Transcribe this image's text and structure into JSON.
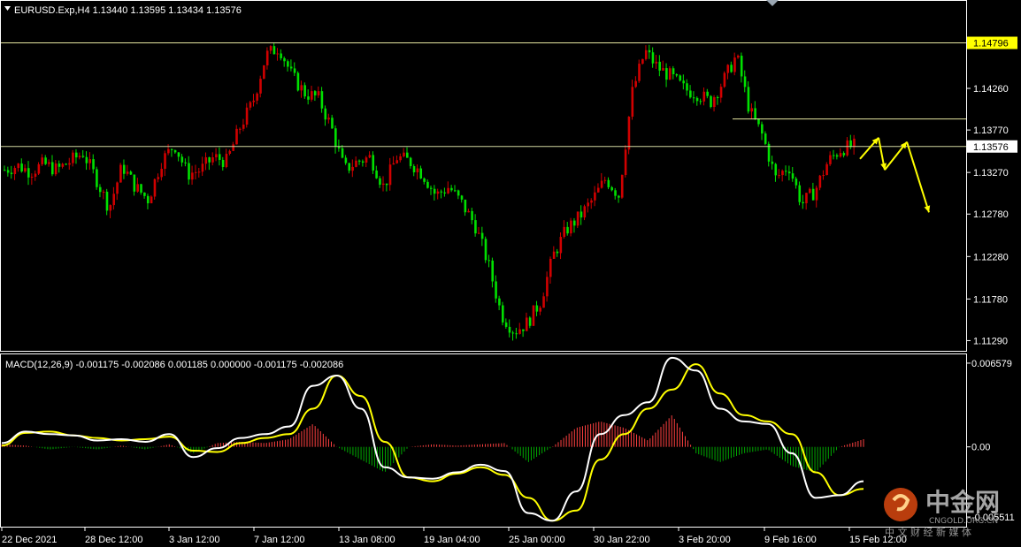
{
  "window": {
    "symbol_header": "EURUSD.Exp,H4  1.13440 1.13595 1.13434 1.13576",
    "collapse_icon": "triangle-down-icon"
  },
  "colors": {
    "background": "#000000",
    "frame": "#ffffff",
    "bull_candle": "#d00000",
    "bear_candle": "#00e000",
    "hline": "#e6e6a0",
    "yellow": "#ffff00",
    "macd_main": "#ffffff",
    "macd_signal": "#ffff00",
    "hist_pos": "#ff4040",
    "hist_neg": "#00aa00"
  },
  "price_axis": {
    "ticks": [
      "1.14260",
      "1.13770",
      "1.13270",
      "1.12780",
      "1.12280",
      "1.11780",
      "1.11290"
    ],
    "highlight_label": "1.14796",
    "current_label": "1.13576"
  },
  "macd_panel": {
    "header": "MACD(12,26,9) -0.001175 -0.002086 0.001185 0.000000 -0.001175 -0.002086",
    "ticks": [
      "0.006579",
      "0.00",
      "-0.005511"
    ]
  },
  "time_axis": {
    "labels": [
      "22 Dec 2021",
      "28 Dec 12:00",
      "3 Jan 12:00",
      "7 Jan 12:00",
      "13 Jan 08:00",
      "19 Jan 04:00",
      "25 Jan 00:00",
      "30 Jan 22:00",
      "3 Feb 20:00",
      "9 Feb 16:00",
      "15 Feb 12:00"
    ]
  },
  "watermark": {
    "brand": "中金网",
    "domain": "CNGOLD.ORG.CN",
    "slogan": "中 文 财 经 新 媒 体",
    "logo_icon": "cngold-logo-icon"
  },
  "chart_data": [
    {
      "type": "candlestick",
      "title": "EURUSD.Exp,H4",
      "ohlc_last": {
        "open": 1.1344,
        "high": 1.13595,
        "low": 1.13434,
        "close": 1.13576
      },
      "ylim": [
        1.1118,
        1.1528
      ],
      "x": [
        "22 Dec 2021",
        "28 Dec 12:00",
        "3 Jan 12:00",
        "7 Jan 12:00",
        "13 Jan 08:00",
        "19 Jan 04:00",
        "25 Jan 00:00",
        "30 Jan 22:00",
        "3 Feb 20:00",
        "9 Feb 16:00",
        "15 Feb 12:00"
      ],
      "close_path": [
        1.133,
        1.1335,
        1.1328,
        1.1337,
        1.133,
        1.134,
        1.135,
        1.132,
        1.1285,
        1.1335,
        1.131,
        1.1295,
        1.134,
        1.136,
        1.1325,
        1.133,
        1.1345,
        1.134,
        1.138,
        1.141,
        1.1465,
        1.1475,
        1.144,
        1.142,
        1.1415,
        1.138,
        1.133,
        1.134,
        1.1345,
        1.131,
        1.1345,
        1.134,
        1.1325,
        1.13,
        1.131,
        1.129,
        1.1265,
        1.122,
        1.116,
        1.114,
        1.115,
        1.1175,
        1.123,
        1.126,
        1.1275,
        1.1295,
        1.132,
        1.13,
        1.142,
        1.147,
        1.145,
        1.144,
        1.1425,
        1.142,
        1.141,
        1.1435,
        1.1465,
        1.14,
        1.137,
        1.132,
        1.1335,
        1.129,
        1.1305,
        1.134,
        1.1355,
        1.1358
      ],
      "horizontal_lines": [
        1.14796,
        1.139,
        1.13576
      ],
      "projection_path": [
        1.1343,
        1.1368,
        1.133,
        1.1363,
        1.128
      ]
    },
    {
      "type": "line",
      "title": "MACD(12,26,9)",
      "ylim": [
        -0.0062,
        0.0072
      ],
      "values": {
        "main": -0.001175,
        "signal": -0.002086,
        "histogram": 0.001185
      },
      "series": [
        {
          "name": "main",
          "values": [
            0.0003,
            0.0012,
            0.001,
            0.0009,
            0.0005,
            0.0006,
            0.0004,
            0.001,
            -0.0008,
            -0.0001,
            0.0007,
            0.001,
            0.0016,
            0.0048,
            0.0056,
            0.003,
            -0.0016,
            -0.0024,
            -0.0025,
            -0.002,
            -0.0014,
            -0.0019,
            -0.0052,
            -0.0058,
            -0.0035,
            0.001,
            0.0025,
            0.0035,
            0.007,
            0.006,
            0.003,
            0.002,
            0.0018,
            -0.0005,
            -0.004,
            -0.0038,
            -0.0027
          ]
        },
        {
          "name": "signal",
          "values": [
            0.0001,
            0.0011,
            0.0012,
            0.0009,
            0.0007,
            0.0005,
            0.0006,
            0.0008,
            -0.0003,
            -0.0004,
            0.0003,
            0.0007,
            0.001,
            0.003,
            0.0056,
            0.004,
            0.0004,
            -0.0024,
            -0.0027,
            -0.0021,
            -0.0016,
            -0.0022,
            -0.004,
            -0.0058,
            -0.005,
            -0.001,
            0.001,
            0.003,
            0.0045,
            0.0065,
            0.0042,
            0.0025,
            0.002,
            0.001,
            -0.002,
            -0.0038,
            -0.0033
          ]
        },
        {
          "name": "histogram",
          "values": [
            0.0002,
            0.0001,
            -0.0002,
            0.0,
            -0.0002,
            0.0001,
            -0.0002,
            0.0002,
            -0.0005,
            0.0003,
            0.0004,
            0.0003,
            0.0006,
            0.0018,
            0.0,
            -0.001,
            -0.002,
            0.0,
            0.0002,
            0.0001,
            0.0002,
            0.0003,
            -0.0012,
            0.0,
            0.0015,
            0.002,
            0.0015,
            0.0005,
            0.0025,
            -0.0005,
            -0.0012,
            -0.0005,
            -0.0002,
            -0.0015,
            -0.002,
            0.0,
            0.0006
          ]
        }
      ]
    }
  ]
}
